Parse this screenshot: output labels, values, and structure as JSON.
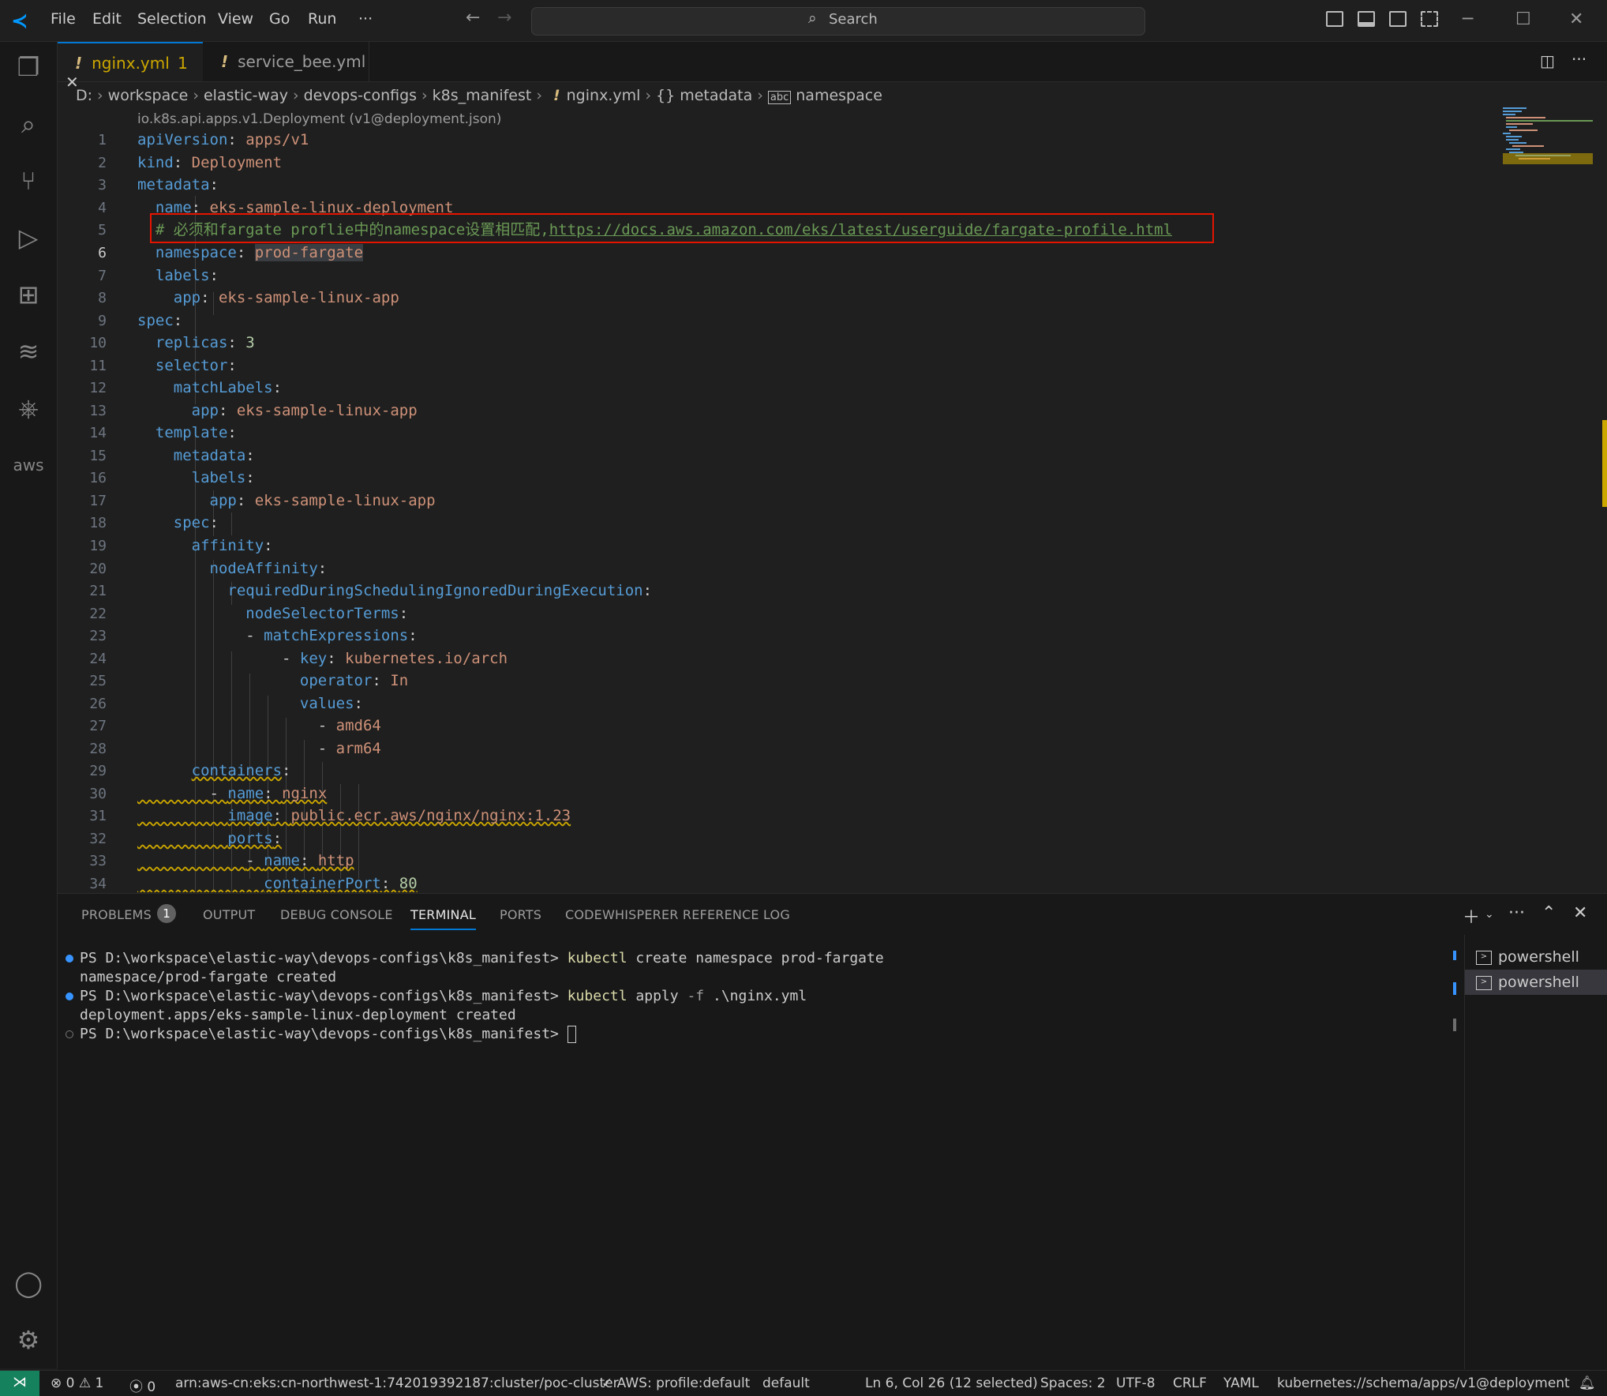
{
  "menu": [
    "File",
    "Edit",
    "Selection",
    "View",
    "Go",
    "Run",
    "···"
  ],
  "search": {
    "label": "Search"
  },
  "tabs": [
    {
      "name": "nginx.yml",
      "badge": "1",
      "close": "✕"
    },
    {
      "name": "service_bee.yml"
    }
  ],
  "breadcrumb": [
    "D:",
    "workspace",
    "elastic-way",
    "devops-configs",
    "k8s_manifest",
    "nginx.yml",
    "metadata",
    "namespace"
  ],
  "codelens": "io.k8s.api.apps.v1.Deployment (v1@deployment.json)",
  "code": {
    "l1": {
      "n": "1",
      "k": "apiVersion",
      "v": "apps/v1"
    },
    "l2": {
      "n": "2",
      "k": "kind",
      "v": "Deployment"
    },
    "l3": {
      "n": "3",
      "k": "metadata"
    },
    "l4": {
      "n": "4",
      "k": "name",
      "v": "eks-sample-linux-deployment"
    },
    "l5": {
      "n": "5",
      "comment": "# 必须和fargate proflie中的namespace设置相匹配,",
      "url": "https://docs.aws.amazon.com/eks/latest/userguide/fargate-profile.html"
    },
    "l6": {
      "n": "6",
      "k": "namespace",
      "v": "prod-fargate"
    },
    "l7": {
      "n": "7",
      "k": "labels"
    },
    "l8": {
      "n": "8",
      "k": "app",
      "v": "eks-sample-linux-app"
    },
    "l9": {
      "n": "9",
      "k": "spec"
    },
    "l10": {
      "n": "10",
      "k": "replicas",
      "v": "3"
    },
    "l11": {
      "n": "11",
      "k": "selector"
    },
    "l12": {
      "n": "12",
      "k": "matchLabels"
    },
    "l13": {
      "n": "13",
      "k": "app",
      "v": "eks-sample-linux-app"
    },
    "l14": {
      "n": "14",
      "k": "template"
    },
    "l15": {
      "n": "15",
      "k": "metadata"
    },
    "l16": {
      "n": "16",
      "k": "labels"
    },
    "l17": {
      "n": "17",
      "k": "app",
      "v": "eks-sample-linux-app"
    },
    "l18": {
      "n": "18",
      "k": "spec"
    },
    "l19": {
      "n": "19",
      "k": "affinity"
    },
    "l20": {
      "n": "20",
      "k": "nodeAffinity"
    },
    "l21": {
      "n": "21",
      "k": "requiredDuringSchedulingIgnoredDuringExecution"
    },
    "l22": {
      "n": "22",
      "k": "nodeSelectorTerms"
    },
    "l23": {
      "n": "23",
      "k": "matchExpressions"
    },
    "l24": {
      "n": "24",
      "k": "key",
      "v": "kubernetes.io/arch"
    },
    "l25": {
      "n": "25",
      "k": "operator",
      "v": "In"
    },
    "l26": {
      "n": "26",
      "k": "values"
    },
    "l27": {
      "n": "27",
      "v": "amd64"
    },
    "l28": {
      "n": "28",
      "v": "arm64"
    },
    "l29": {
      "n": "29",
      "k": "containers"
    },
    "l30": {
      "n": "30",
      "k": "name",
      "v": "nginx"
    },
    "l31": {
      "n": "31",
      "k": "image",
      "v": "public.ecr.aws/nginx/nginx:1.23"
    },
    "l32": {
      "n": "32",
      "k": "ports"
    },
    "l33": {
      "n": "33",
      "k": "name",
      "v": "http"
    },
    "l34": {
      "n": "34",
      "k": "containerPort",
      "v": "80"
    }
  },
  "panel": {
    "tabs": [
      "PROBLEMS",
      "OUTPUT",
      "DEBUG CONSOLE",
      "TERMINAL",
      "PORTS",
      "CODEWHISPERER REFERENCE LOG"
    ],
    "problems_count": "1",
    "terminal": {
      "prompt": "PS D:\\workspace\\elastic-way\\devops-configs\\k8s_manifest>",
      "cmd1": "kubectl",
      "cmd1_args": "create namespace prod-fargate",
      "out1": "namespace/prod-fargate created",
      "cmd2": "kubectl",
      "cmd2_args1": "apply",
      "cmd2_flag": "-f",
      "cmd2_args2": ".\\nginx.yml",
      "out2": "deployment.apps/eks-sample-linux-deployment created"
    },
    "terminals": [
      "powershell",
      "powershell"
    ]
  },
  "statusbar": {
    "errors": "0",
    "warnings": "1",
    "ports": "0",
    "cluster": "arn:aws-cn:eks:cn-northwest-1:742019392187:cluster/poc-cluster",
    "aws_profile": "AWS: profile:default",
    "default": "default",
    "position": "Ln 6, Col 26 (12 selected)",
    "spaces": "Spaces: 2",
    "encoding": "UTF-8",
    "eol": "CRLF",
    "language": "YAML",
    "schema": "kubernetes://schema/apps/v1@deployment"
  },
  "colors": {
    "accent": "#0078d4",
    "remote": "#16825d",
    "warning": "#cca700",
    "highlight_box": "#e51400"
  }
}
